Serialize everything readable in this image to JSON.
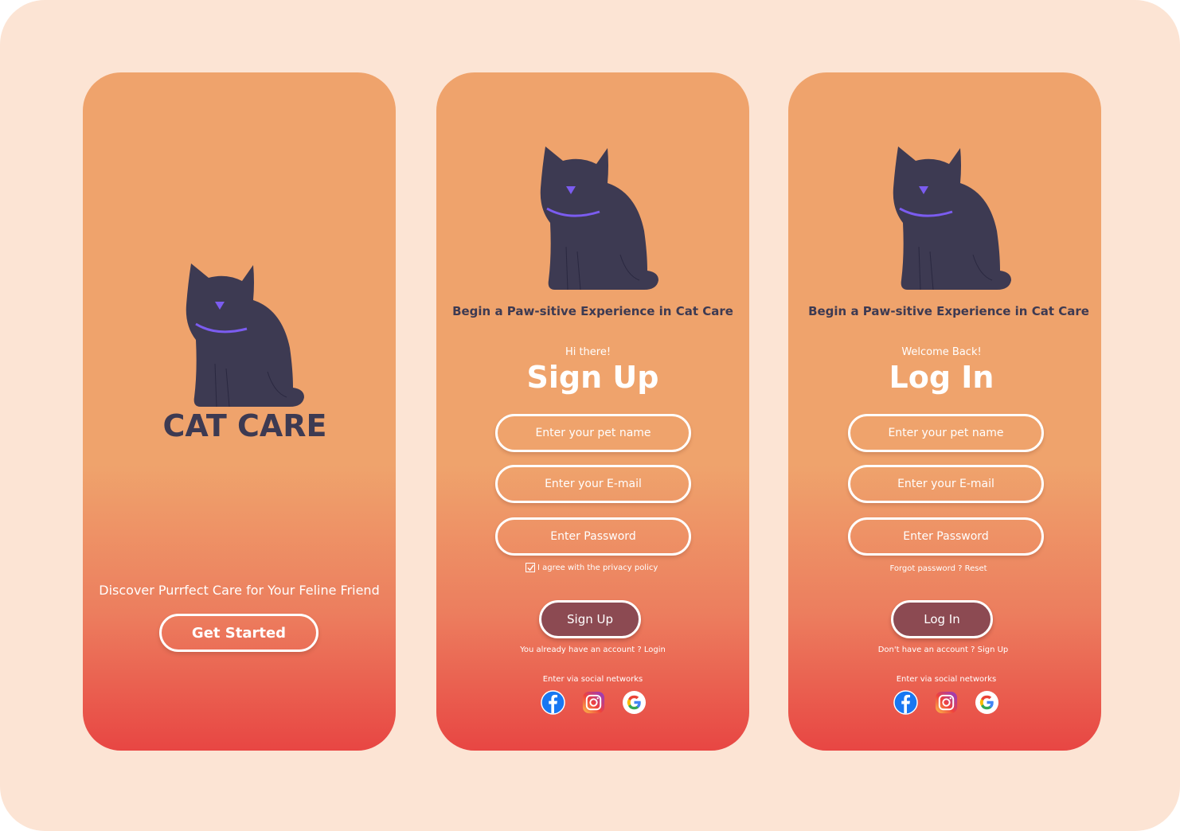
{
  "colors": {
    "background": "#fce4d4",
    "gradient_top": "#efa36c",
    "gradient_bottom": "#e84643",
    "dark_text": "#3d3a52",
    "button_fill": "#8c4a52",
    "collar": "#7b5cf0"
  },
  "splash": {
    "brand": "CAT CARE",
    "tagline": "Discover Purrfect Care for Your Feline Friend",
    "cta": "Get Started",
    "illustration_icon": "cat-icon"
  },
  "signup": {
    "headline": "Begin a Paw-sitive Experience in Cat Care",
    "greeting": "Hi there!",
    "title": "Sign Up",
    "fields": {
      "pet_name": "Enter your pet name",
      "email": "Enter your E-mail",
      "password": "Enter Password"
    },
    "agree": "I agree with the privacy policy",
    "agree_checked": true,
    "button": "Sign Up",
    "account_prompt": "You already have an account ?",
    "account_link": "Login",
    "social_label": "Enter via social networks"
  },
  "login": {
    "headline": "Begin a Paw-sitive Experience in Cat Care",
    "greeting": "Welcome Back!",
    "title": "Log In",
    "fields": {
      "pet_name": "Enter your pet name",
      "email": "Enter your E-mail",
      "password": "Enter Password"
    },
    "forgot": "Forgot password ?",
    "forgot_link": "Reset",
    "button": "Log In",
    "account_prompt": "Don't have an account ?",
    "account_link": "Sign Up",
    "social_label": "Enter via social networks"
  },
  "social_icons": [
    "facebook-icon",
    "instagram-icon",
    "google-icon"
  ]
}
